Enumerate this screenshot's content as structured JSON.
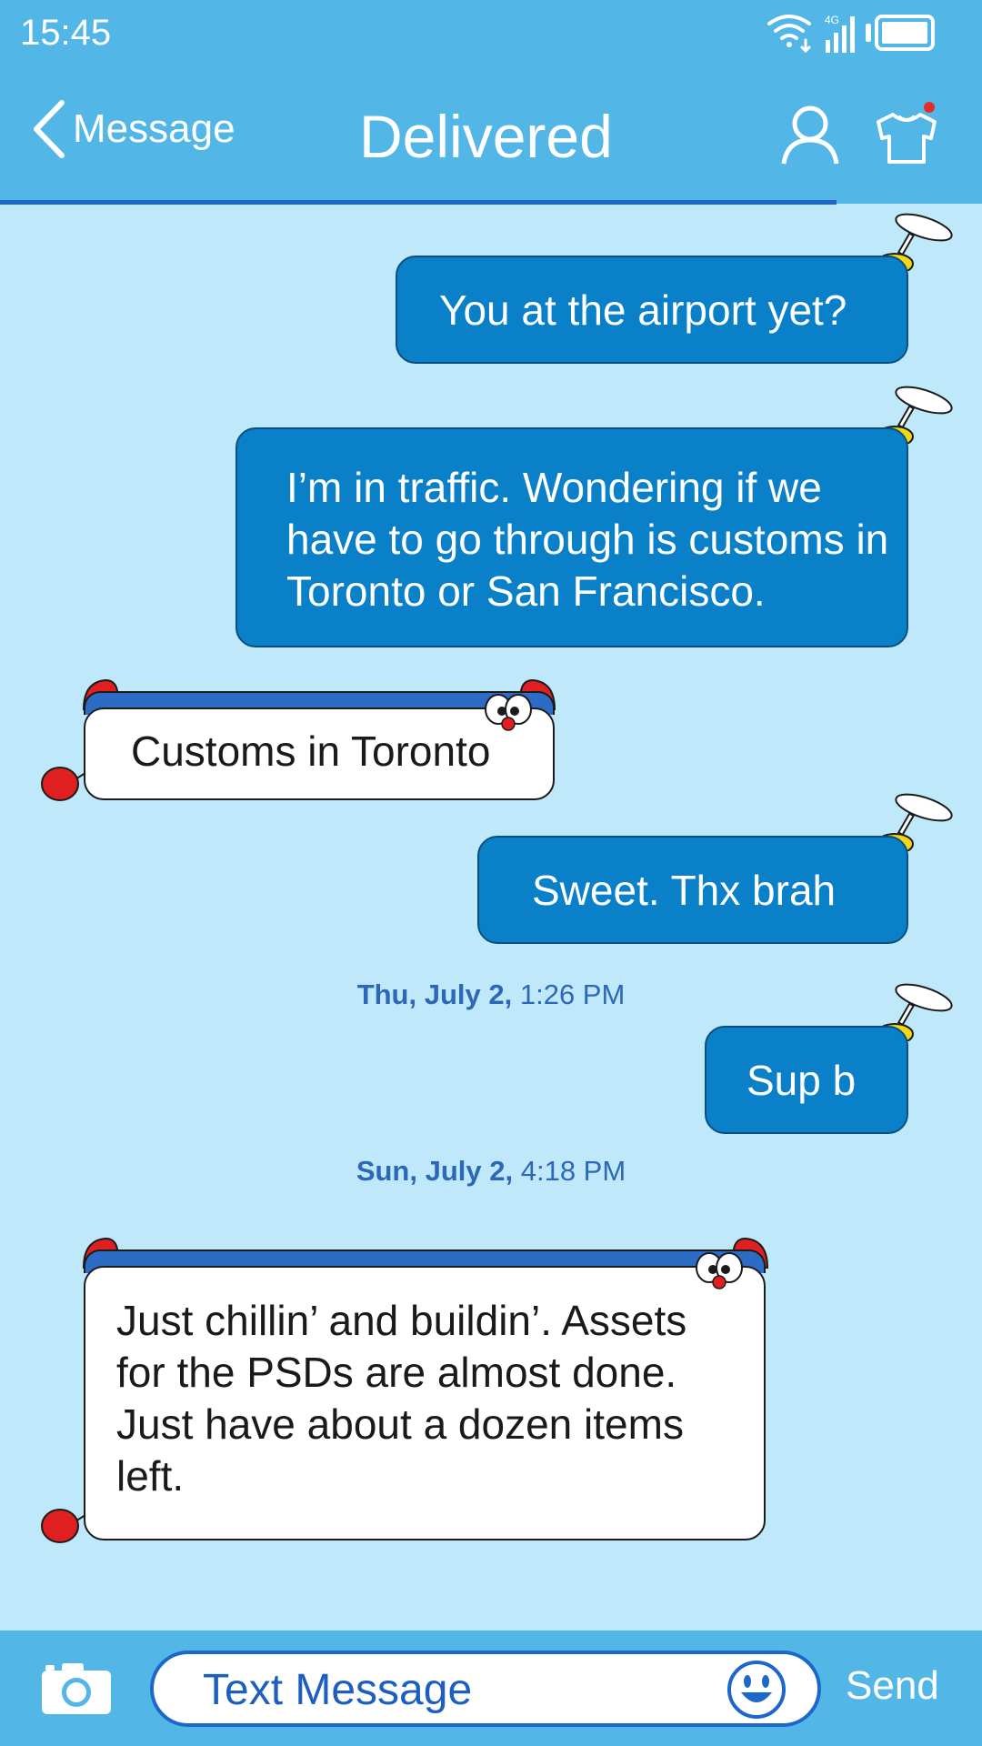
{
  "status_bar": {
    "time": "15:45",
    "network": "4G"
  },
  "header": {
    "back_label": "Message",
    "title": "Delivered"
  },
  "messages": [
    {
      "direction": "out",
      "text": "You at the airport yet?"
    },
    {
      "direction": "out",
      "text": "I’m in traffic. Wondering if we have to go through is customs in Toronto or San Francisco."
    },
    {
      "direction": "in",
      "text": "Customs in Toronto"
    },
    {
      "direction": "out",
      "text": "Sweet. Thx brah"
    },
    {
      "direction": "out",
      "text": "Sup b"
    },
    {
      "direction": "in",
      "text": "Just chillin’ and buildin’. Assets for the PSDs are almost done. Just have about a dozen items left."
    }
  ],
  "timestamps": [
    {
      "date": "Thu, July 2,",
      "time": "1:26 PM"
    },
    {
      "date": "Sun, July 2,",
      "time": "4:18 PM"
    }
  ],
  "composer": {
    "placeholder": "Text Message",
    "send_label": "Send"
  },
  "colors": {
    "bar": "#52b7e6",
    "background": "#bfe9fb",
    "outgoing_bubble": "#0a80c8",
    "incoming_bubble": "#ffffff",
    "accent": "#1d67c9",
    "notification_dot": "#e52b2b"
  },
  "icons": [
    "back-chevron-icon",
    "wifi-icon",
    "signal-icon",
    "battery-icon",
    "user-icon",
    "tshirt-icon",
    "camera-icon",
    "smiley-icon",
    "propeller-icon",
    "doraemon-face-icon",
    "bell-icon"
  ]
}
